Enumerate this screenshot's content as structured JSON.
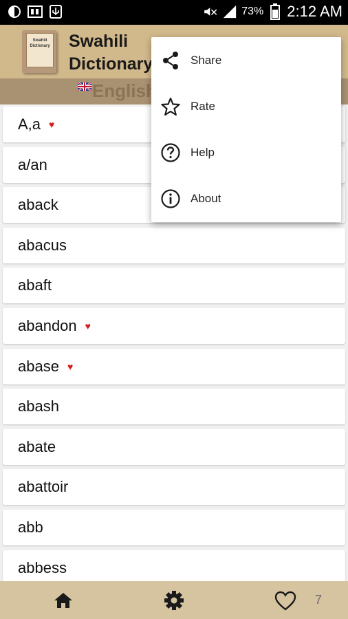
{
  "status_bar": {
    "battery_percent": "73%",
    "time": "2:12 AM"
  },
  "header": {
    "title_line1": "Swahili",
    "title_line2": "Dictionary",
    "book_text_line1": "Swahili",
    "book_text_line2": "Dictionary",
    "language": "English"
  },
  "words": [
    {
      "text": "A,a",
      "favorite": true
    },
    {
      "text": "a/an",
      "favorite": false
    },
    {
      "text": "aback",
      "favorite": false
    },
    {
      "text": "abacus",
      "favorite": false
    },
    {
      "text": "abaft",
      "favorite": false
    },
    {
      "text": "abandon",
      "favorite": true
    },
    {
      "text": "abase",
      "favorite": true
    },
    {
      "text": "abash",
      "favorite": false
    },
    {
      "text": "abate",
      "favorite": false
    },
    {
      "text": "abattoir",
      "favorite": false
    },
    {
      "text": "abb",
      "favorite": false
    },
    {
      "text": "abbess",
      "favorite": false
    }
  ],
  "menu": {
    "items": [
      {
        "label": "Share",
        "icon": "share-icon"
      },
      {
        "label": "Rate",
        "icon": "star-icon"
      },
      {
        "label": "Help",
        "icon": "help-icon"
      },
      {
        "label": "About",
        "icon": "info-icon"
      }
    ]
  },
  "bottom_bar": {
    "favorites_count": "7"
  },
  "colors": {
    "header_bg": "#d2b98b",
    "subbar_bg": "#a99272",
    "bottom_bg": "#d6c4a0",
    "favorite_heart": "#d21e1e"
  }
}
